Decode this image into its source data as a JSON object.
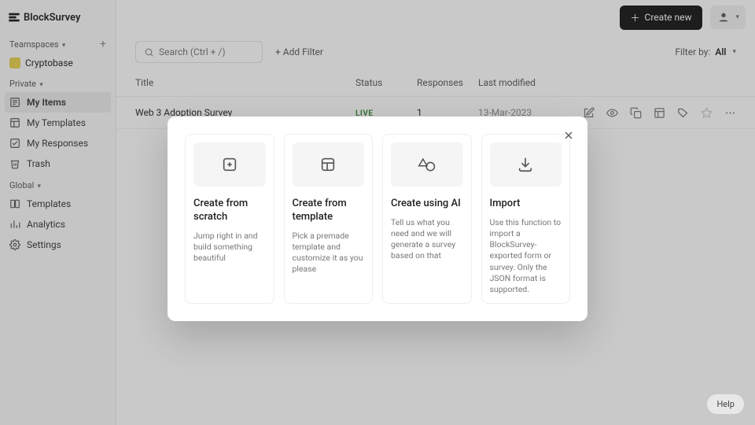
{
  "brand": "BlockSurvey",
  "sidebar": {
    "teamspaces_label": "Teamspaces",
    "workspace_name": "Cryptobase",
    "private_label": "Private",
    "global_label": "Global",
    "private_items": [
      {
        "label": "My Items"
      },
      {
        "label": "My Templates"
      },
      {
        "label": "My Responses"
      },
      {
        "label": "Trash"
      }
    ],
    "global_items": [
      {
        "label": "Templates"
      },
      {
        "label": "Analytics"
      },
      {
        "label": "Settings"
      }
    ]
  },
  "topbar": {
    "create_label": "Create new"
  },
  "toolbar": {
    "search_placeholder": "Search (Ctrl + /)",
    "add_filter_label": "+ Add Filter",
    "filter_by_label": "Filter by:",
    "filter_value": "All"
  },
  "table": {
    "headers": {
      "title": "Title",
      "status": "Status",
      "responses": "Responses",
      "modified": "Last modified"
    },
    "rows": [
      {
        "title": "Web 3 Adoption Survey",
        "status": "LIVE",
        "responses": "1",
        "modified": "13-Mar-2023"
      }
    ]
  },
  "modal": {
    "cards": [
      {
        "title": "Create from scratch",
        "desc": "Jump right in and build something beautiful"
      },
      {
        "title": "Create from template",
        "desc": "Pick a premade template and customize it as you please"
      },
      {
        "title": "Create using AI",
        "desc": "Tell us what you need and we will generate a survey based on that"
      },
      {
        "title": "Import",
        "desc": "Use this function to import a BlockSurvey-exported form or survey. Only the JSON format is supported."
      }
    ]
  },
  "help_label": "Help"
}
